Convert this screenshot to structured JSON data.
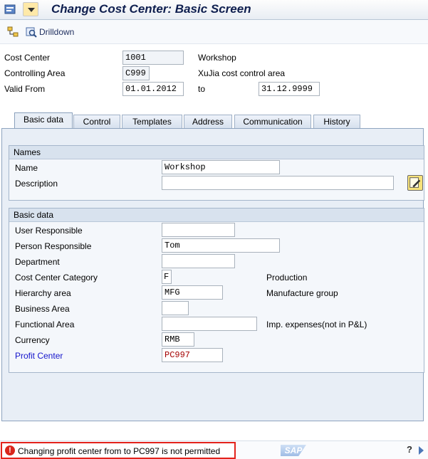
{
  "window": {
    "title": "Change Cost Center: Basic Screen"
  },
  "toolbar": {
    "drilldown_label": "Drilldown"
  },
  "header": {
    "cost_center_label": "Cost Center",
    "cost_center_value": "1001",
    "cost_center_desc": "Workshop",
    "controlling_area_label": "Controlling Area",
    "controlling_area_value": "C999",
    "controlling_area_desc": "XuJia cost control area",
    "valid_from_label": "Valid From",
    "valid_from_value": "01.01.2012",
    "to_label": "to",
    "valid_to_value": "31.12.9999"
  },
  "tabs": [
    {
      "label": "Basic data",
      "active": true
    },
    {
      "label": "Control"
    },
    {
      "label": "Templates"
    },
    {
      "label": "Address"
    },
    {
      "label": "Communication"
    },
    {
      "label": "History"
    }
  ],
  "names_group": {
    "title": "Names",
    "name_label": "Name",
    "name_value": "Workshop",
    "description_label": "Description",
    "description_value": ""
  },
  "basic_group": {
    "title": "Basic data",
    "user_responsible_label": "User Responsible",
    "user_responsible_value": "",
    "person_responsible_label": "Person Responsible",
    "person_responsible_value": "Tom",
    "department_label": "Department",
    "department_value": "",
    "category_label": "Cost Center Category",
    "category_value": "F",
    "category_desc": "Production",
    "hierarchy_label": "Hierarchy area",
    "hierarchy_value": "MFG",
    "hierarchy_desc": "Manufacture group",
    "business_area_label": "Business Area",
    "business_area_value": "",
    "functional_area_label": "Functional Area",
    "functional_area_value": "",
    "functional_area_desc": "Imp. expenses(not in P&L)",
    "currency_label": "Currency",
    "currency_value": "RMB",
    "profit_center_label": "Profit Center",
    "profit_center_value": "PC997"
  },
  "status": {
    "type": "error",
    "message": "Changing profit center from  to PC997 is not permitted",
    "logo_text": "SAP"
  },
  "colors": {
    "error_border": "#e3221b",
    "profit_center_link": "#1515cc",
    "profit_center_value": "#a40000"
  }
}
